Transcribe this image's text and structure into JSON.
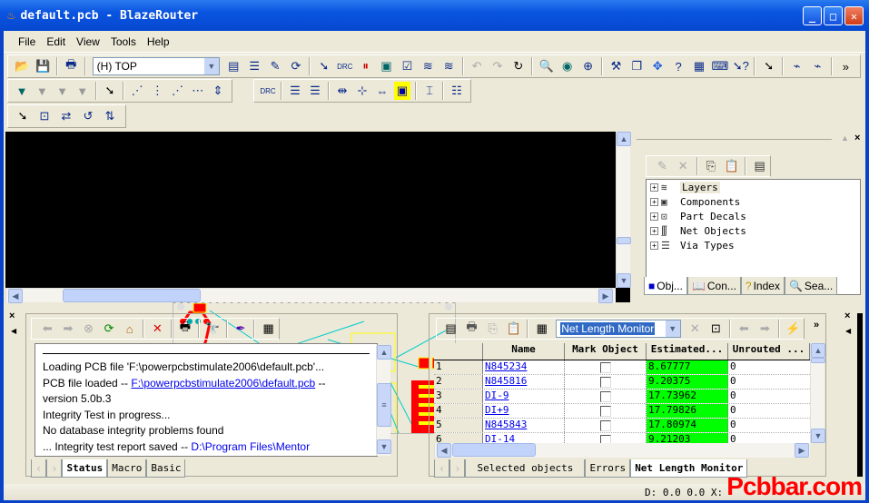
{
  "window": {
    "title": "default.pcb - BlazeRouter",
    "app_icon": "flame-icon",
    "buttons": [
      "minimize",
      "maximize",
      "close"
    ]
  },
  "menu": [
    {
      "label": "File",
      "mnemonic": "F"
    },
    {
      "label": "Edit",
      "mnemonic": "E"
    },
    {
      "label": "View",
      "mnemonic": "V"
    },
    {
      "label": "Tools",
      "mnemonic": "T"
    },
    {
      "label": "Help",
      "mnemonic": "H"
    }
  ],
  "toolbar": {
    "layer_combo": {
      "value": "(H) TOP"
    },
    "overflow": "»"
  },
  "project_explorer": {
    "tree": [
      {
        "label": "Layers",
        "icon": "layers-icon"
      },
      {
        "label": "Components",
        "icon": "component-icon"
      },
      {
        "label": "Part Decals",
        "icon": "part-decal-icon"
      },
      {
        "label": "Net Objects",
        "icon": "net-icon"
      },
      {
        "label": "Via Types",
        "icon": "via-icon"
      }
    ],
    "tabs": [
      {
        "label": "Obj...",
        "icon": "objects-icon",
        "active": true
      },
      {
        "label": "Con...",
        "icon": "book-icon"
      },
      {
        "label": "Index",
        "icon": "help-icon"
      },
      {
        "label": "Sea...",
        "icon": "search-icon"
      }
    ]
  },
  "output_window": {
    "log": [
      {
        "text": "Loading PCB file 'F:\\powerpcbstimulate2006\\default.pcb'..."
      },
      {
        "text": "PCB file loaded -- ",
        "link": "F:\\powerpcbstimulate2006\\default.pcb",
        "suffix": "  --"
      },
      {
        "text": "version 5.0b.3"
      },
      {
        "text": "Integrity Test  in progress..."
      },
      {
        "text": "No database integrity problems found"
      },
      {
        "text": "... Integrity test report saved -- ",
        "link": "D:\\Program Files\\Mentor"
      }
    ],
    "tabs": [
      {
        "label": "Status",
        "active": true
      },
      {
        "label": "Macro"
      },
      {
        "label": "Basic"
      }
    ]
  },
  "spreadsheet": {
    "combo": {
      "value": "Net Length Monitor"
    },
    "columns": [
      "",
      "Name",
      "Mark Object",
      "Estimated...",
      "Unrouted ..."
    ],
    "rows": [
      {
        "n": "1",
        "name": "N845234",
        "mark": false,
        "estimated": "8.67777",
        "unrouted": "0"
      },
      {
        "n": "2",
        "name": "N845816",
        "mark": false,
        "estimated": "9.20375",
        "unrouted": "0"
      },
      {
        "n": "3",
        "name": "DI-9",
        "mark": false,
        "estimated": "17.73962",
        "unrouted": "0"
      },
      {
        "n": "4",
        "name": "DI+9",
        "mark": false,
        "estimated": "17.79826",
        "unrouted": "0"
      },
      {
        "n": "5",
        "name": "N845843",
        "mark": false,
        "estimated": "17.80974",
        "unrouted": "0"
      },
      {
        "n": "6",
        "name": "DI-14",
        "mark": false,
        "estimated": "9.21203",
        "unrouted": "0"
      }
    ],
    "highlight_color": "#00ff00",
    "tabs": [
      {
        "label": "Selected objects"
      },
      {
        "label": "Errors"
      },
      {
        "label": "Net Length Monitor",
        "active": true
      }
    ]
  },
  "statusbar": {
    "coords": "D: 0.0 0.0  X:"
  },
  "watermark": "Pcbbar.com"
}
